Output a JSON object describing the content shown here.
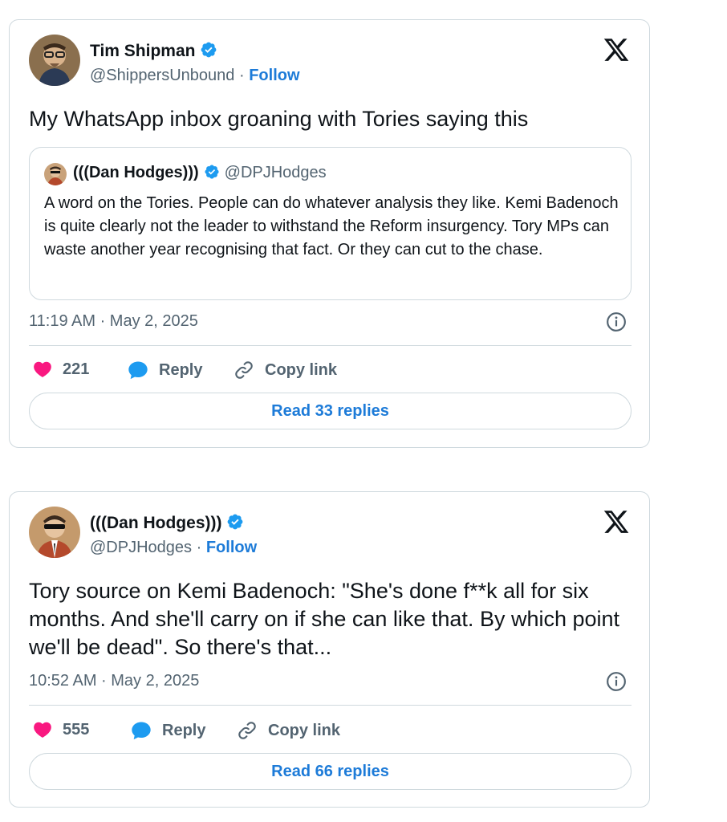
{
  "colors": {
    "accent": "#1d7bd8",
    "like": "#f91880",
    "muted": "#536471",
    "border": "#cfd9de"
  },
  "tweets": [
    {
      "author": {
        "name": "Tim Shipman",
        "handle": "@ShippersUnbound",
        "verified": true
      },
      "follow_label": "Follow",
      "separator": "·",
      "text": "My WhatsApp inbox groaning with Tories saying this",
      "quote": {
        "author": {
          "name": "(((Dan Hodges)))",
          "handle": "@DPJHodges",
          "verified": true
        },
        "text": "A word on the Tories. People can do whatever analysis they like. Kemi Badenoch is quite clearly not the leader to withstand the Reform insurgency. Tory MPs can waste another year recognising that fact. Or they can cut to the chase."
      },
      "timestamp": "11:19 AM · May 2, 2025",
      "likes": "221",
      "reply_label": "Reply",
      "copy_label": "Copy link",
      "read_replies_label": "Read 33 replies"
    },
    {
      "author": {
        "name": "(((Dan Hodges)))",
        "handle": "@DPJHodges",
        "verified": true
      },
      "follow_label": "Follow",
      "separator": "·",
      "text": "Tory source on Kemi Badenoch: \"She's done f**k all for six months. And she'll carry on if she can like that. By which point we'll be dead\". So there's that...",
      "timestamp": "10:52 AM · May 2, 2025",
      "likes": "555",
      "reply_label": "Reply",
      "copy_label": "Copy link",
      "read_replies_label": "Read 66 replies"
    }
  ],
  "icons": {
    "platform": "x-logo-icon",
    "verified": "verified-badge-icon",
    "like": "heart-icon",
    "reply": "speech-bubble-icon",
    "copy": "link-icon",
    "info": "info-icon"
  }
}
